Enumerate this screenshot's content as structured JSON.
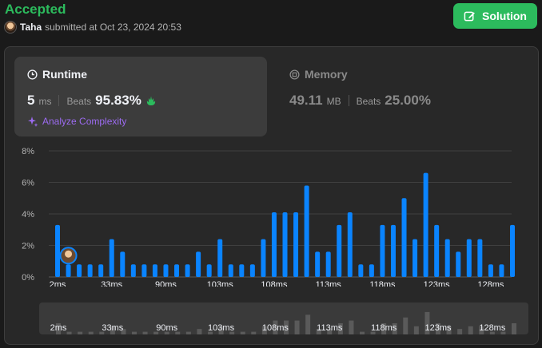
{
  "header": {
    "status": "Accepted",
    "user": "Taha",
    "submitted_text": "submitted at Oct 23, 2024 20:53",
    "solution_label": "Solution"
  },
  "runtime": {
    "title": "Runtime",
    "value": "5",
    "unit": "ms",
    "beats_label": "Beats",
    "beats_value": "95.83%",
    "analyze_label": "Analyze Complexity"
  },
  "memory": {
    "title": "Memory",
    "value": "49.11",
    "unit": "MB",
    "beats_label": "Beats",
    "beats_value": "25.00%"
  },
  "colors": {
    "accent": "#2cbb5d",
    "bar": "#0a84ff",
    "overview_bar": "#5a5a5a"
  },
  "chart_data": {
    "type": "bar",
    "ylabel": "",
    "xlabel": "",
    "ylim": [
      0,
      8
    ],
    "yticks": [
      "0%",
      "2%",
      "4%",
      "6%",
      "8%"
    ],
    "xtick_labels": [
      {
        "index": 0,
        "label": "2ms"
      },
      {
        "index": 5,
        "label": "33ms"
      },
      {
        "index": 10,
        "label": "90ms"
      },
      {
        "index": 15,
        "label": "103ms"
      },
      {
        "index": 20,
        "label": "108ms"
      },
      {
        "index": 25,
        "label": "113ms"
      },
      {
        "index": 30,
        "label": "118ms"
      },
      {
        "index": 35,
        "label": "123ms"
      },
      {
        "index": 40,
        "label": "128ms"
      }
    ],
    "values": [
      3.3,
      0.8,
      0.8,
      0.8,
      0.8,
      2.4,
      1.6,
      0.8,
      0.8,
      0.8,
      0.8,
      0.8,
      0.8,
      1.6,
      0.8,
      2.4,
      0.8,
      0.8,
      0.8,
      2.4,
      4.1,
      4.1,
      4.1,
      5.8,
      1.6,
      1.6,
      3.3,
      4.1,
      0.8,
      0.8,
      3.3,
      3.3,
      5.0,
      2.4,
      6.6,
      3.3,
      2.4,
      1.6,
      2.4,
      2.4,
      0.8,
      0.8,
      3.3
    ],
    "user_marker_index": 1
  }
}
